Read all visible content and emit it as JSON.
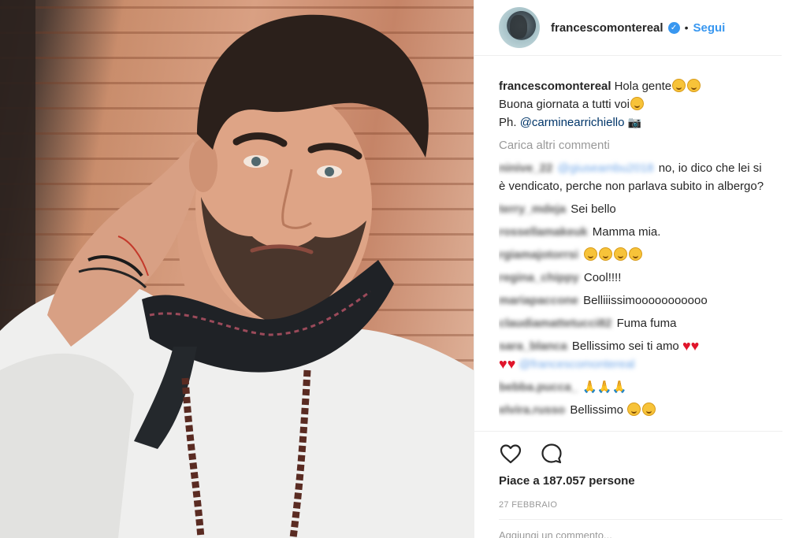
{
  "post": {
    "username": "francescomontereal",
    "verified_glyph": "✓",
    "separator": "•",
    "follow_label": "Segui",
    "caption": {
      "user": "francescomontereal",
      "line1": "Hola gente",
      "line2": "Buona giornata a tutti voi",
      "line3_prefix": "Ph.",
      "mention": "@carminearrichiello"
    },
    "load_more_label": "Carica altri commenti",
    "comments": [
      {
        "user": "ninive_22",
        "mention": "@giuseambu2018",
        "text": "no, io dico che lei si è vendicato, perche non parlava subito in albergo?"
      },
      {
        "user": "terry_mdeja",
        "text": "Sei bello"
      },
      {
        "user": "rossellamakeuk",
        "text": "Mamma mia."
      },
      {
        "user": "rgiamajotorrsi",
        "text": ""
      },
      {
        "user": "regina_chippy",
        "text": "Cool!!!!"
      },
      {
        "user": "mariapaccone",
        "text": "Belliiissimooooooooooo"
      },
      {
        "user": "claudiamattetucci82",
        "text": "Fuma fuma"
      },
      {
        "user": "sara_blanca",
        "text": "Bellissimo sei ti amo",
        "mention": "@francescomontereal"
      },
      {
        "user": "bebba.pucca_",
        "text": ""
      },
      {
        "user": "elvira.russo",
        "text": "Bellissimo"
      }
    ],
    "likes_label": "Piace a 187.057 persone",
    "date_label": "27 FEBBRAIO",
    "add_comment_placeholder": "Aggiungi un commento..."
  },
  "icons": {
    "like": "heart-outline-icon",
    "comment": "speech-bubble-icon",
    "camera": "camera-icon"
  },
  "colors": {
    "link_blue": "#3897f0",
    "mention_blue": "#003569",
    "muted_gray": "#999999",
    "text": "#262626",
    "heart_red": "#e0152b"
  }
}
